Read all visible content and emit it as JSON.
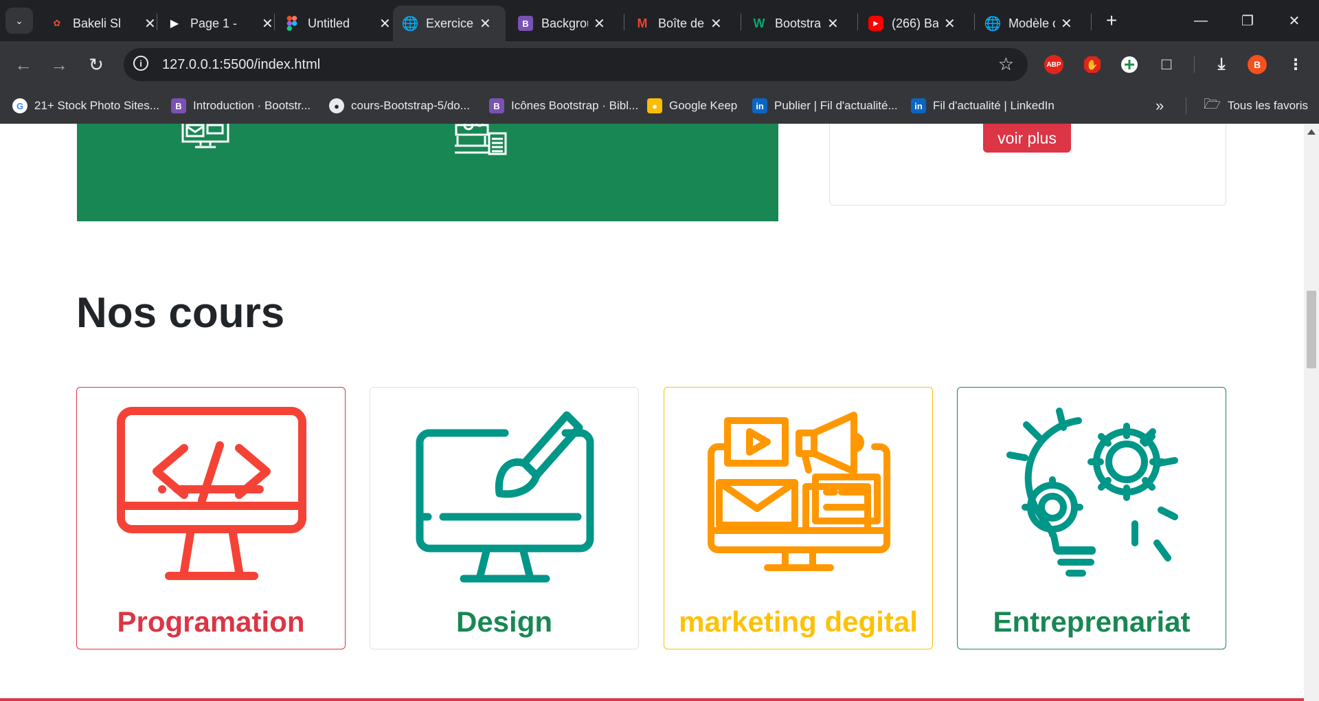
{
  "browser": {
    "tabs": [
      {
        "title": "Bakeli Sl",
        "icon": "bakeli-logo",
        "color": "#202124"
      },
      {
        "title": "Page 1 -",
        "icon": "play-icon",
        "color": "#202124"
      },
      {
        "title": "Untitled",
        "icon": "figma-logo",
        "color": "#202124"
      },
      {
        "title": "Exercice",
        "icon": "globe-icon",
        "color": "#35363a",
        "active": true
      },
      {
        "title": "Backgrou",
        "icon": "bootstrap-logo",
        "color": "#7952b3"
      },
      {
        "title": "Boîte de",
        "icon": "gmail-logo",
        "color": "#202124"
      },
      {
        "title": "Bootstra",
        "icon": "w3schools-logo",
        "color": "#202124"
      },
      {
        "title": "(266) Ba",
        "icon": "youtube-logo",
        "color": "#ff0000"
      },
      {
        "title": "Modèle c",
        "icon": "globe-icon",
        "color": "#202124"
      }
    ],
    "tab_letters": {
      "bootstrap": "B",
      "w3": "W"
    },
    "url": "127.0.0.1:5500/index.html",
    "extensions": {
      "abp": "ABP",
      "profile": "B"
    },
    "bookmarks": [
      {
        "label": "21+ Stock Photo Sites...",
        "icon": "google-logo"
      },
      {
        "label": "Introduction · Bootstr...",
        "icon": "bootstrap-logo"
      },
      {
        "label": "cours-Bootstrap-5/do...",
        "icon": "github-logo"
      },
      {
        "label": "Icônes Bootstrap · Bibl...",
        "icon": "bootstrap-logo"
      },
      {
        "label": "Google Keep",
        "icon": "keep-logo"
      },
      {
        "label": "Publier | Fil d'actualité...",
        "icon": "linkedin-logo"
      },
      {
        "label": "Fil d'actualité | LinkedIn",
        "icon": "linkedin-logo"
      }
    ],
    "bookmark_letters": {
      "google": "G",
      "bootstrap": "B",
      "linkedin": "in"
    },
    "all_bookmarks": "Tous les favoris"
  },
  "page": {
    "voir_plus": "voir plus",
    "section_title": "Nos cours",
    "courses": [
      {
        "title": "Programation",
        "color": "#dc3545",
        "icon": "code-monitor-icon"
      },
      {
        "title": "Design",
        "color": "#198754",
        "icon": "design-monitor-icon"
      },
      {
        "title": "marketing degital",
        "color": "#ffc107",
        "icon": "marketing-icon"
      },
      {
        "title": "Entreprenariat",
        "color": "#198754",
        "icon": "idea-gears-icon"
      }
    ]
  }
}
